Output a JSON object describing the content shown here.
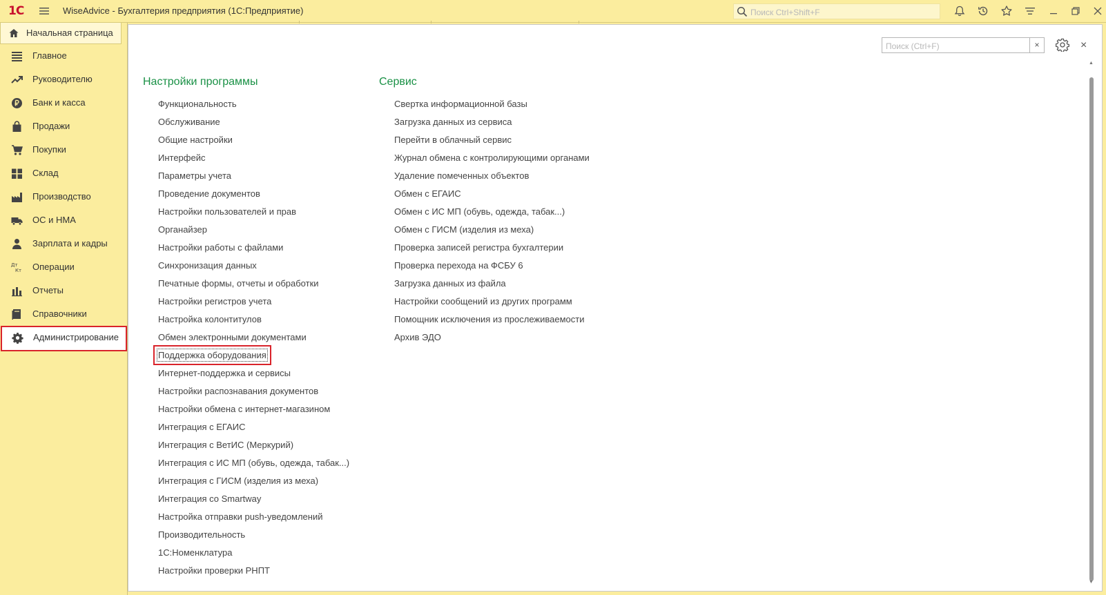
{
  "window": {
    "logo_text": "1С",
    "title": "WiseAdvice - Бухгалтерия предприятия  (1С:Предприятие)",
    "search_placeholder": "Поиск Ctrl+Shift+F",
    "icons": [
      "menu-icon",
      "bell-icon",
      "history-icon",
      "star-icon",
      "settings-lines-icon",
      "minimize-icon",
      "restore-icon",
      "close-icon"
    ]
  },
  "sidebar": {
    "home_label": "Начальная страница",
    "items": [
      {
        "label": "Главное",
        "icon": "list-icon"
      },
      {
        "label": "Руководителю",
        "icon": "trend-icon"
      },
      {
        "label": "Банк и касса",
        "icon": "ruble-icon"
      },
      {
        "label": "Продажи",
        "icon": "bag-icon"
      },
      {
        "label": "Покупки",
        "icon": "cart-icon"
      },
      {
        "label": "Склад",
        "icon": "warehouse-icon"
      },
      {
        "label": "Производство",
        "icon": "factory-icon"
      },
      {
        "label": "ОС и НМА",
        "icon": "truck-icon"
      },
      {
        "label": "Зарплата и кадры",
        "icon": "person-icon"
      },
      {
        "label": "Операции",
        "icon": "dt-kt-icon"
      },
      {
        "label": "Отчеты",
        "icon": "bar-chart-icon"
      },
      {
        "label": "Справочники",
        "icon": "books-icon"
      },
      {
        "label": "Администрирование",
        "icon": "gear-icon",
        "selected": true
      }
    ]
  },
  "panel": {
    "search_placeholder": "Поиск (Ctrl+F)",
    "clear_label": "×",
    "close_label": "×"
  },
  "sections": {
    "settings": {
      "title": "Настройки программы",
      "links": [
        "Функциональность",
        "Обслуживание",
        "Общие настройки",
        "Интерфейс",
        "Параметры учета",
        "Проведение документов",
        "Настройки пользователей и прав",
        "Органайзер",
        "Настройки работы с файлами",
        "Синхронизация данных",
        "Печатные формы, отчеты и обработки",
        "Настройки регистров учета",
        "Настройка колонтитулов",
        "Обмен электронными документами",
        "Поддержка оборудования",
        "Интернет-поддержка и сервисы",
        "Настройки распознавания документов",
        "Настройки обмена с интернет-магазином",
        "Интеграция с ЕГАИС",
        "Интеграция с ВетИС (Меркурий)",
        "Интеграция с ИС МП (обувь, одежда, табак...)",
        "Интеграция с ГИСМ (изделия из меха)",
        "Интеграция со Smartway",
        "Настройка отправки push-уведомлений",
        "Производительность",
        "1С:Номенклатура",
        "Настройки проверки РНПТ"
      ],
      "focused_link": "Поддержка оборудования"
    },
    "service": {
      "title": "Сервис",
      "links": [
        "Свертка информационной базы",
        "Загрузка данных из сервиса",
        "Перейти в облачный сервис",
        "Журнал обмена с контролирующими органами",
        "Удаление помеченных объектов",
        "Обмен с ЕГАИС",
        "Обмен с ИС МП (обувь, одежда, табак...)",
        "Обмен с ГИСМ (изделия из меха)",
        "Проверка записей регистра бухгалтерии",
        "Проверка перехода на ФСБУ 6",
        "Загрузка данных из файла",
        "Настройки сообщений из других программ",
        "Помощник исключения из прослеживаемости",
        "Архив ЭДО"
      ]
    }
  },
  "colors": {
    "chrome": "#fbed9e",
    "section_title": "#1a9146",
    "highlight_border": "#d9232a"
  }
}
